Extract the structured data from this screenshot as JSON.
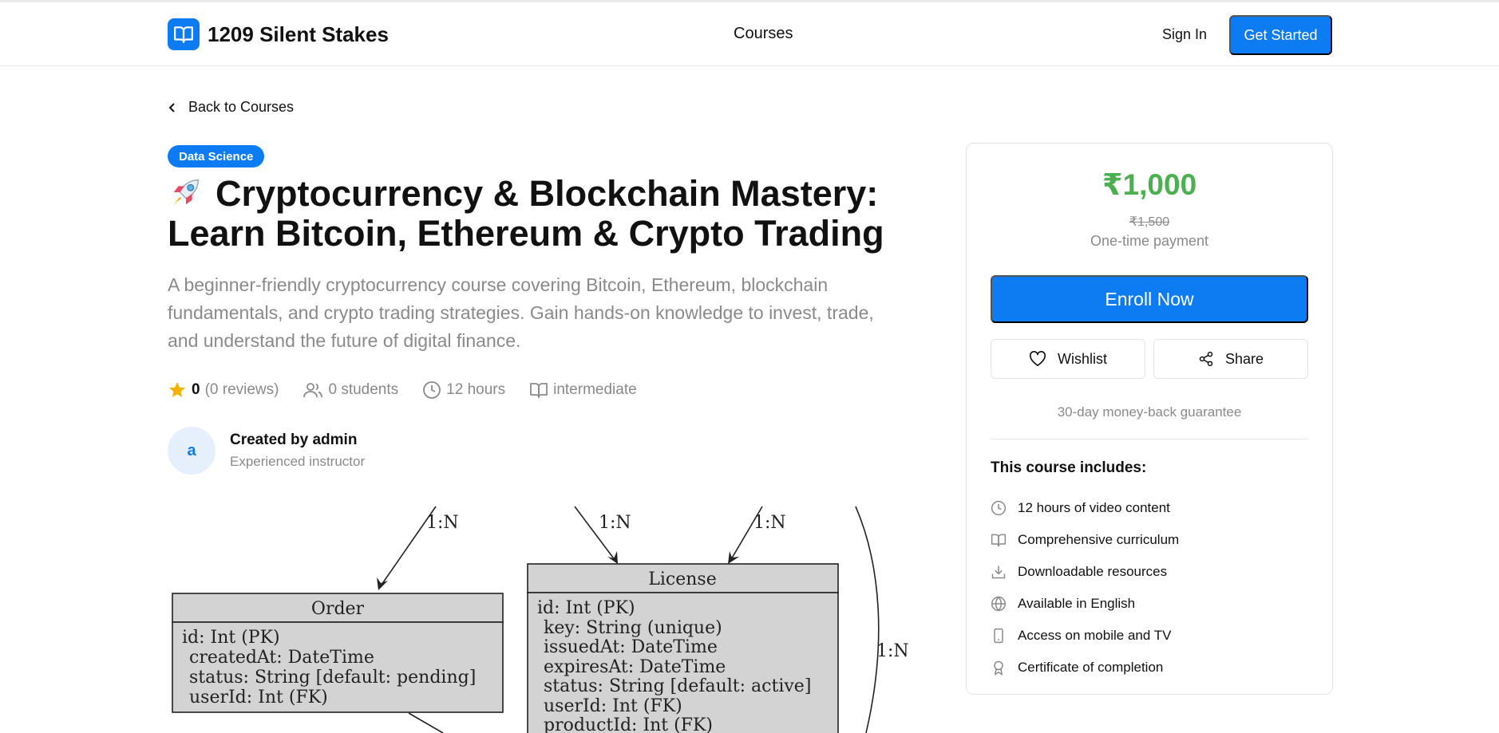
{
  "header": {
    "brand_name": "1209 Silent Stakes",
    "nav_courses": "Courses",
    "sign_in": "Sign In",
    "get_started": "Get Started"
  },
  "back_link": "Back to Courses",
  "course": {
    "category": "Data Science",
    "title": "Cryptocurrency & Blockchain Mastery: Learn Bitcoin, Ethereum & Crypto Trading",
    "title_icon": "rocket-emoji",
    "description": "A beginner-friendly cryptocurrency course covering Bitcoin, Ethereum, blockchain fundamentals, and crypto trading strategies. Gain hands-on knowledge to invest, trade, and understand the future of digital finance.",
    "rating": "0",
    "reviews": "(0 reviews)",
    "students": "0 students",
    "duration": "12 hours",
    "level": "intermediate"
  },
  "author": {
    "initial": "a",
    "name": "Created by admin",
    "role": "Experienced instructor"
  },
  "diagram": {
    "relation_labels": [
      "1:N",
      "1:N",
      "1:N",
      "1:N"
    ],
    "order": {
      "name": "Order",
      "fields": [
        "id: Int (PK)",
        "createdAt: DateTime",
        "status: String [default: pending]",
        "userId: Int (FK)"
      ]
    },
    "license": {
      "name": "License",
      "fields": [
        "id: Int (PK)",
        "key: String (unique)",
        "issuedAt: DateTime",
        "expiresAt: DateTime",
        "status: String [default: active]",
        "userId: Int (FK)",
        "productId: Int (FK)"
      ]
    }
  },
  "sidebar": {
    "price": "₹1,000",
    "original_price": "₹1,500",
    "payment_type": "One-time payment",
    "enroll": "Enroll Now",
    "wishlist": "Wishlist",
    "share": "Share",
    "guarantee": "30-day money-back guarantee",
    "includes_title": "This course includes:",
    "includes": [
      {
        "icon": "clock-icon",
        "label": "12 hours of video content"
      },
      {
        "icon": "book-icon",
        "label": "Comprehensive curriculum"
      },
      {
        "icon": "download-icon",
        "label": "Downloadable resources"
      },
      {
        "icon": "globe-icon",
        "label": "Available in English"
      },
      {
        "icon": "mobile-icon",
        "label": "Access on mobile and TV"
      },
      {
        "icon": "award-icon",
        "label": "Certificate of completion"
      }
    ]
  },
  "colors": {
    "primary": "#0d7cf2",
    "price_green": "#4caf50",
    "muted_text": "#8a8a8a",
    "star": "#f5b301"
  }
}
